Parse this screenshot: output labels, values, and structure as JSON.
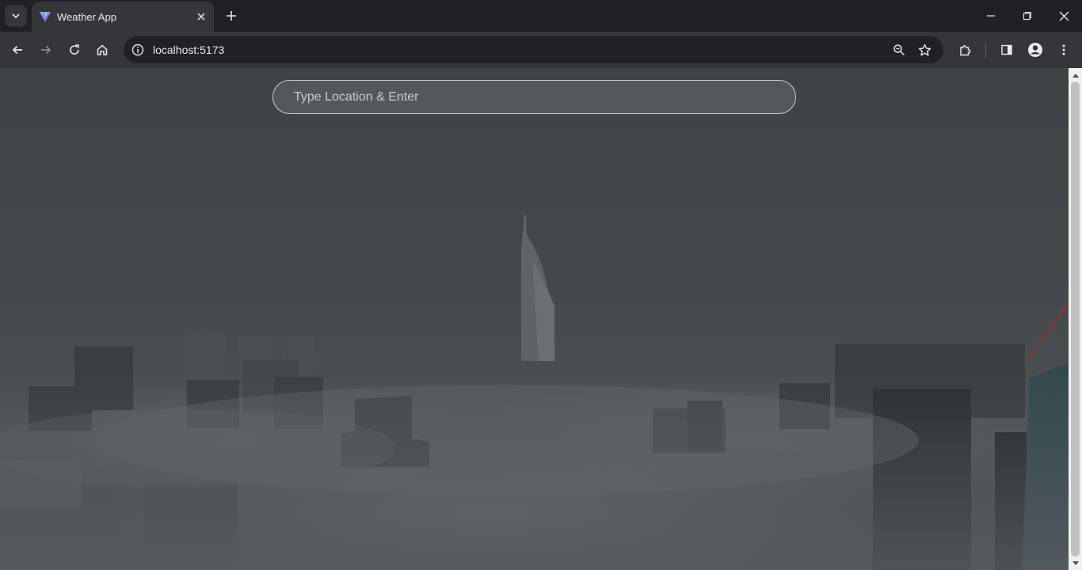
{
  "browser": {
    "tab": {
      "title": "Weather App"
    },
    "address": {
      "url": "localhost:5173"
    }
  },
  "page": {
    "search": {
      "placeholder": "Type Location & Enter",
      "value": ""
    }
  },
  "colors": {
    "browser_frame": "#202124",
    "toolbar": "#35363a",
    "text": "#e8eaed"
  }
}
